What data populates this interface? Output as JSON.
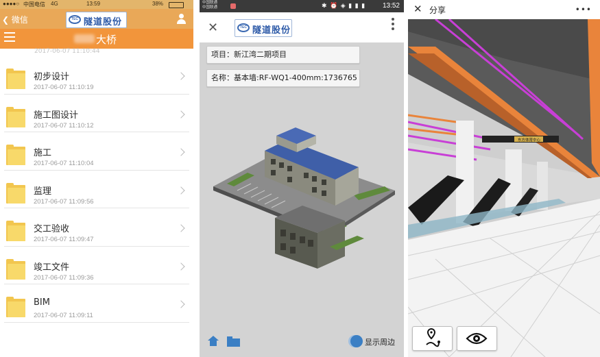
{
  "panel1": {
    "status": {
      "carrier": "中国电信",
      "network": "4G",
      "time": "13:59",
      "battery": "38%"
    },
    "wechat_bar": {
      "back_label": "微信",
      "logo_text": "隧道股份",
      "logo_mark": "TEC"
    },
    "title_bar": {
      "title": "大桥"
    },
    "ghost_date": "2017-06-07 11:10:44",
    "folders": [
      {
        "name": "初步设计",
        "date": "2017-06-07 11:10:19"
      },
      {
        "name": "施工图设计",
        "date": "2017-06-07 11:10:12"
      },
      {
        "name": "施工",
        "date": "2017-06-07 11:10:04"
      },
      {
        "name": "监理",
        "date": "2017-06-07 11:09:56"
      },
      {
        "name": "交工验收",
        "date": "2017-06-07 11:09:47"
      },
      {
        "name": "竣工文件",
        "date": "2017-06-07 11:09:36"
      },
      {
        "name": "BIM",
        "date": "2017-06-07 11:09:11"
      }
    ],
    "colors": {
      "title_bar": "#f2953b",
      "wechat_bar": "#e9a858",
      "folder": "#f2c64f"
    }
  },
  "panel2": {
    "status": {
      "carrier_line1": "中国联通",
      "carrier_line2": "中国联通",
      "icons": "✱ ⏰ ◈ ▮ ▮ ▮",
      "time": "13:52"
    },
    "logo_text": "隧道股份",
    "logo_mark": "TEC",
    "project_label": "项目：新江湾二期项目",
    "name_label": "名称：基本墙:RF-WQ1-400mm:1736765",
    "toggle_label": "显示周边",
    "icons": {
      "home": "home-icon",
      "folder": "folder-icon"
    },
    "colors": {
      "accent": "#3b7fc4",
      "viewport_bg": "#d3d3d3"
    }
  },
  "panel3": {
    "title": "分享",
    "more": "•••",
    "sign_text": "东方体育中心",
    "icons": {
      "location": "map-route-icon",
      "view": "eye-icon"
    },
    "colors": {
      "pipe_magenta": "#c83fd6",
      "duct_orange": "#e9843b"
    }
  }
}
